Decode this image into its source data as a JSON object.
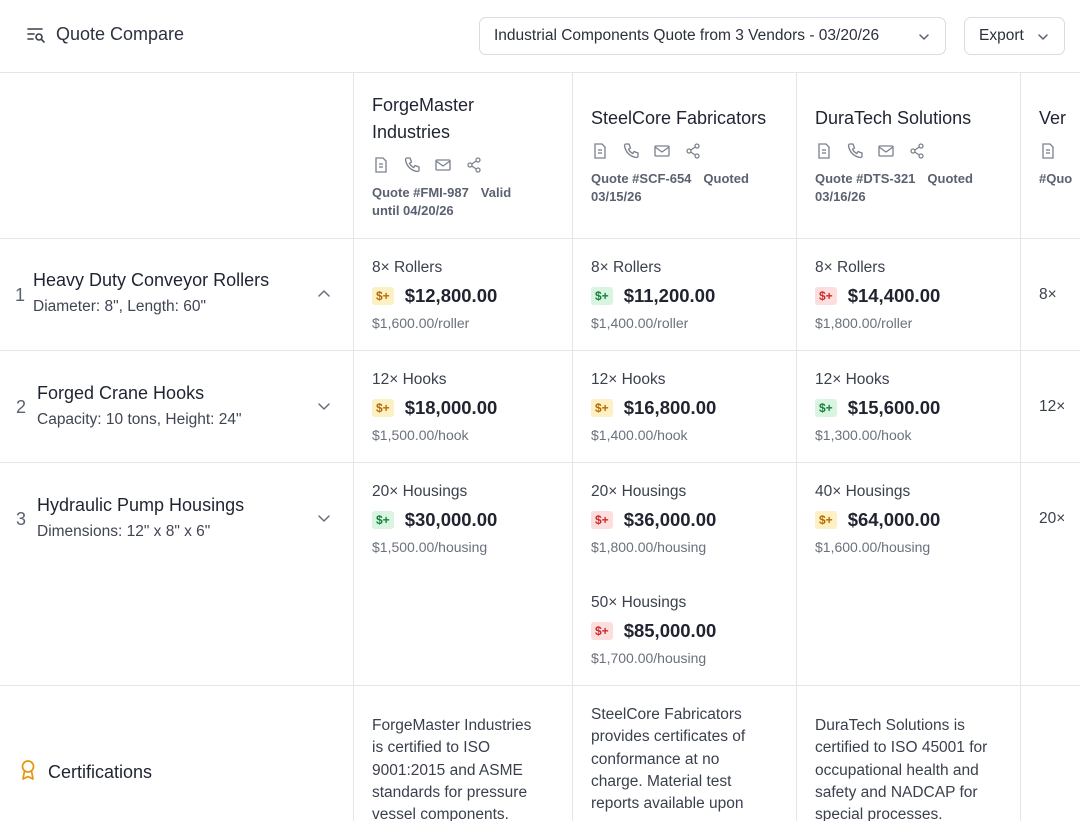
{
  "header": {
    "title": "Quote Compare",
    "quote_select": "Industrial Components Quote from 3 Vendors - 03/20/26",
    "export_label": "Export"
  },
  "vendors": [
    {
      "name_line1": "ForgeMaster",
      "name_line2": "Industries",
      "quote_no": "Quote #FMI-987",
      "status_line1": "Valid",
      "status_line2": "until 04/20/26"
    },
    {
      "name": "SteelCore Fabricators",
      "quote_no": "Quote #SCF-654",
      "status_line1": "Quoted",
      "status_line2": "03/15/26"
    },
    {
      "name": "DuraTech Solutions",
      "quote_no": "Quote #DTS-321",
      "status_line1": "Quoted",
      "status_line2": "03/16/26"
    },
    {
      "name": "Ver",
      "quote_no": "#Quo"
    }
  ],
  "rows": [
    {
      "num": "1",
      "title": "Heavy Duty Conveyor Rollers",
      "sub": "Diameter: 8\", Length: 60\"",
      "cells": [
        {
          "qty": "8× Rollers",
          "badge": "$+",
          "price": "$12,800.00",
          "unit": "$1,600.00/roller",
          "tone": "yellow"
        },
        {
          "qty": "8× Rollers",
          "badge": "$+",
          "price": "$11,200.00",
          "unit": "$1,400.00/roller",
          "tone": "green"
        },
        {
          "qty": "8× Rollers",
          "badge": "$+",
          "price": "$14,400.00",
          "unit": "$1,800.00/roller",
          "tone": "red"
        }
      ],
      "partial": "8×"
    },
    {
      "num": "2",
      "title": "Forged Crane Hooks",
      "sub": "Capacity: 10 tons, Height: 24\"",
      "cells": [
        {
          "qty": "12× Hooks",
          "badge": "$+",
          "price": "$18,000.00",
          "unit": "$1,500.00/hook",
          "tone": "yellow"
        },
        {
          "qty": "12× Hooks",
          "badge": "$+",
          "price": "$16,800.00",
          "unit": "$1,400.00/hook",
          "tone": "yellow"
        },
        {
          "qty": "12× Hooks",
          "badge": "$+",
          "price": "$15,600.00",
          "unit": "$1,300.00/hook",
          "tone": "green"
        }
      ],
      "partial": "12×"
    },
    {
      "num": "3",
      "title": "Hydraulic Pump Housings",
      "sub": "Dimensions: 12\" x 8\" x 6\"",
      "cells": [
        {
          "qty": "20× Housings",
          "badge": "$+",
          "price": "$30,000.00",
          "unit": "$1,500.00/housing",
          "tone": "green"
        },
        {
          "qty": "20× Housings",
          "badge": "$+",
          "price": "$36,000.00",
          "unit": "$1,800.00/housing",
          "tone": "red"
        },
        {
          "qty": "40× Housings",
          "badge": "$+",
          "price": "$64,000.00",
          "unit": "$1,600.00/housing",
          "tone": "yellow"
        }
      ],
      "extra": {
        "qty": "50× Housings",
        "badge": "$+",
        "price": "$85,000.00",
        "unit": "$1,700.00/housing",
        "tone": "red"
      },
      "partial": "20×"
    }
  ],
  "certifications": {
    "title": "Certifications",
    "texts": [
      [
        "ForgeMaster Industries",
        "is certified to ISO",
        "9001:2015 and ASME",
        "standards for pressure",
        "vessel components."
      ],
      [
        "SteelCore Fabricators",
        "provides certificates of",
        "conformance at no",
        "charge. Material test",
        "reports available upon"
      ],
      [
        "DuraTech Solutions is",
        "certified to ISO 45001 for",
        "occupational health and",
        "safety and NADCAP for",
        "special processes."
      ]
    ]
  },
  "colors": {
    "yellow_badge": "#fdf0c4",
    "green_badge": "#d9f5e1",
    "red_badge": "#fddede",
    "cert_icon": "#e8940c"
  },
  "icons": {
    "brand": "list-search-icon",
    "vendor_actions": [
      "document-icon",
      "phone-icon",
      "mail-icon",
      "share-icon"
    ],
    "row_expand": [
      "chevron-up-icon",
      "chevron-down-icon",
      "chevron-down-icon"
    ],
    "certifications": "award-icon"
  }
}
